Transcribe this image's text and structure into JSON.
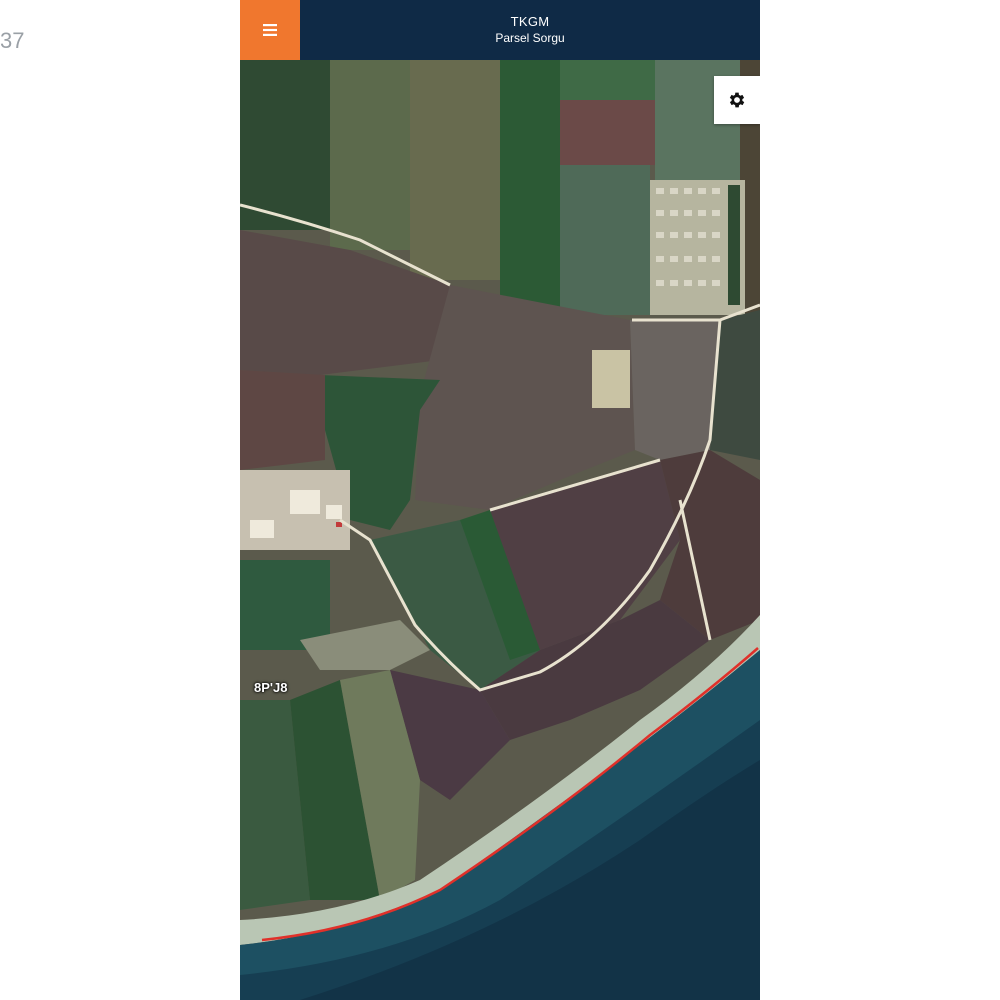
{
  "page": {
    "side_fragment": "37"
  },
  "header": {
    "title": "TKGM",
    "subtitle": "Parsel Sorgu",
    "menu_icon": "hamburger-menu-icon",
    "menu_color": "#f0772e",
    "bar_color": "#0f2a46"
  },
  "map": {
    "layer": "satellite",
    "parcel_label": "8P'J8",
    "boundary_color": "#e0302a",
    "settings_icon": "gear-icon"
  }
}
